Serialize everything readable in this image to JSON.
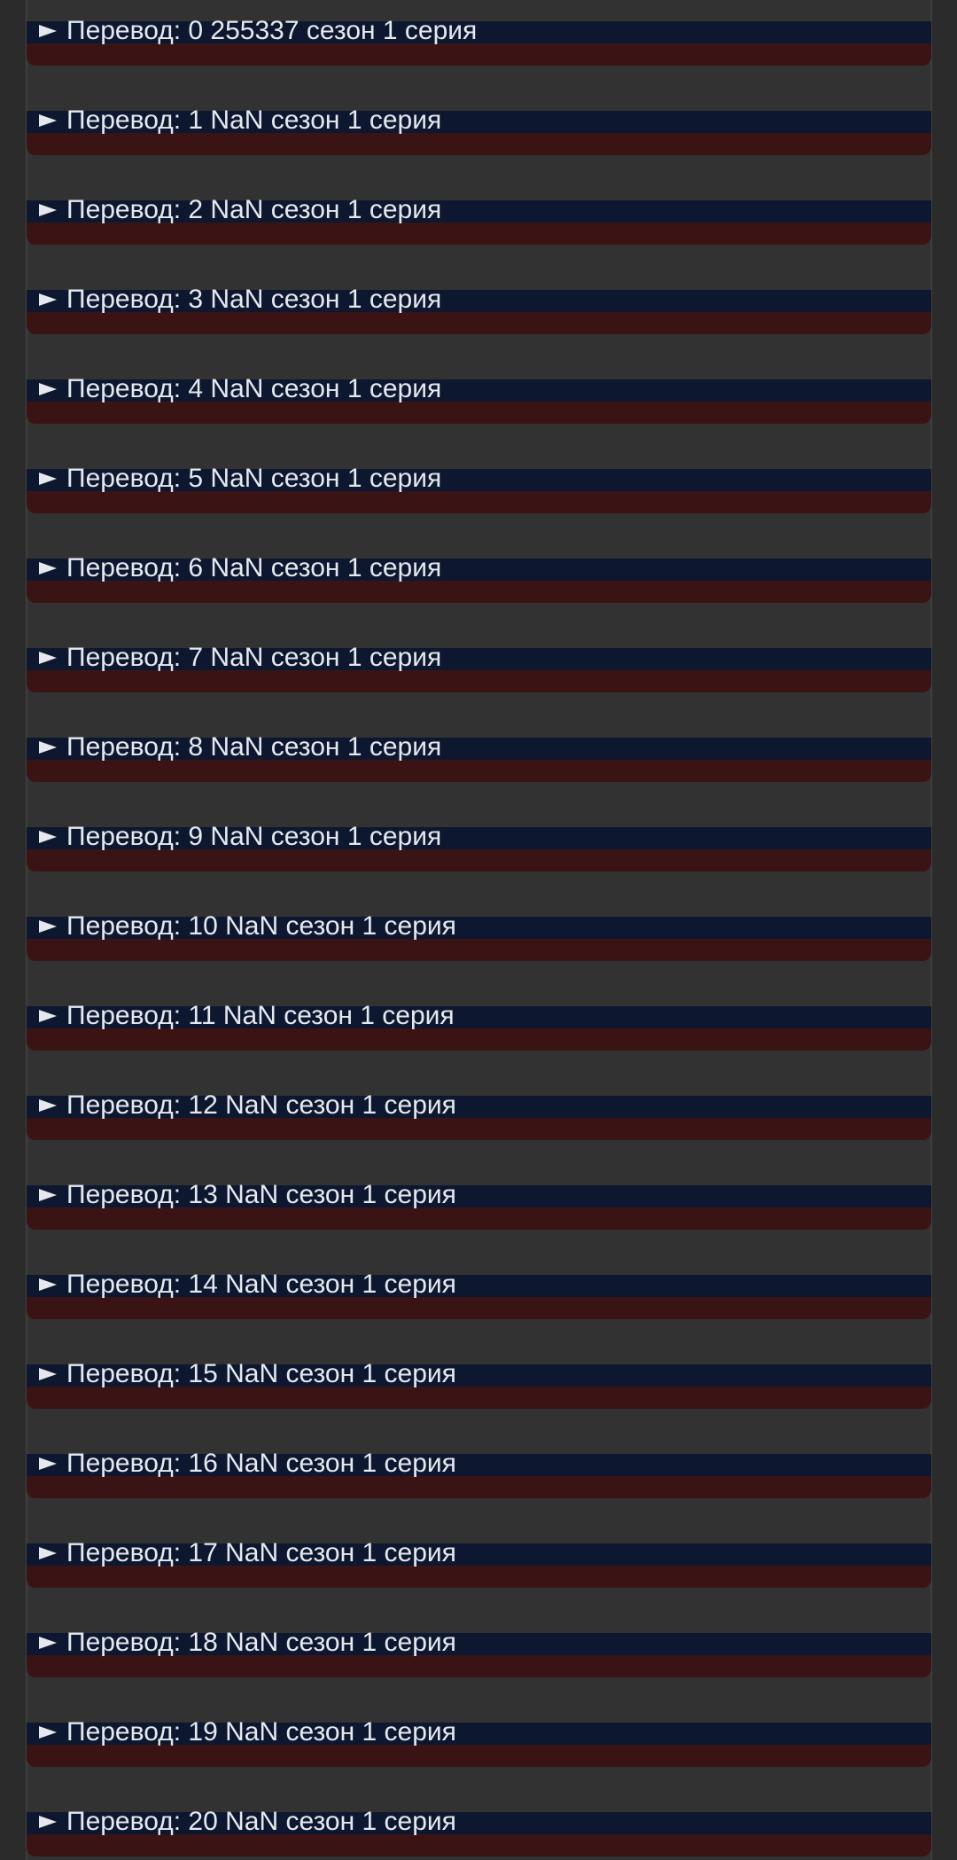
{
  "episodes": {
    "items": [
      {
        "text": "Перевод: 0 255337 сезон 1 серия"
      },
      {
        "text": "Перевод: 1 NaN сезон 1 серия"
      },
      {
        "text": "Перевод: 2 NaN сезон 1 серия"
      },
      {
        "text": "Перевод: 3 NaN сезон 1 серия"
      },
      {
        "text": "Перевод: 4 NaN сезон 1 серия"
      },
      {
        "text": "Перевод: 5 NaN сезон 1 серия"
      },
      {
        "text": "Перевод: 6 NaN сезон 1 серия"
      },
      {
        "text": "Перевод: 7 NaN сезон 1 серия"
      },
      {
        "text": "Перевод: 8 NaN сезон 1 серия"
      },
      {
        "text": "Перевод: 9 NaN сезон 1 серия"
      },
      {
        "text": "Перевод: 10 NaN сезон 1 серия"
      },
      {
        "text": "Перевод: 11 NaN сезон 1 серия"
      },
      {
        "text": "Перевод: 12 NaN сезон 1 серия"
      },
      {
        "text": "Перевод: 13 NaN сезон 1 серия"
      },
      {
        "text": "Перевод: 14 NaN сезон 1 серия"
      },
      {
        "text": "Перевод: 15 NaN сезон 1 серия"
      },
      {
        "text": "Перевод: 16 NaN сезон 1 серия"
      },
      {
        "text": "Перевод: 17 NaN сезон 1 серия"
      },
      {
        "text": "Перевод: 18 NaN сезон 1 серия"
      },
      {
        "text": "Перевод: 19 NaN сезон 1 серия"
      },
      {
        "text": "Перевод: 20 NaN сезон 1 серия"
      }
    ],
    "icon": "play-arrow-icon"
  },
  "colors": {
    "background": "#2b2b2b",
    "panel": "#323232",
    "row_top": "#0d1830",
    "row_bottom": "#3a1414",
    "text": "#e6e8ee"
  }
}
